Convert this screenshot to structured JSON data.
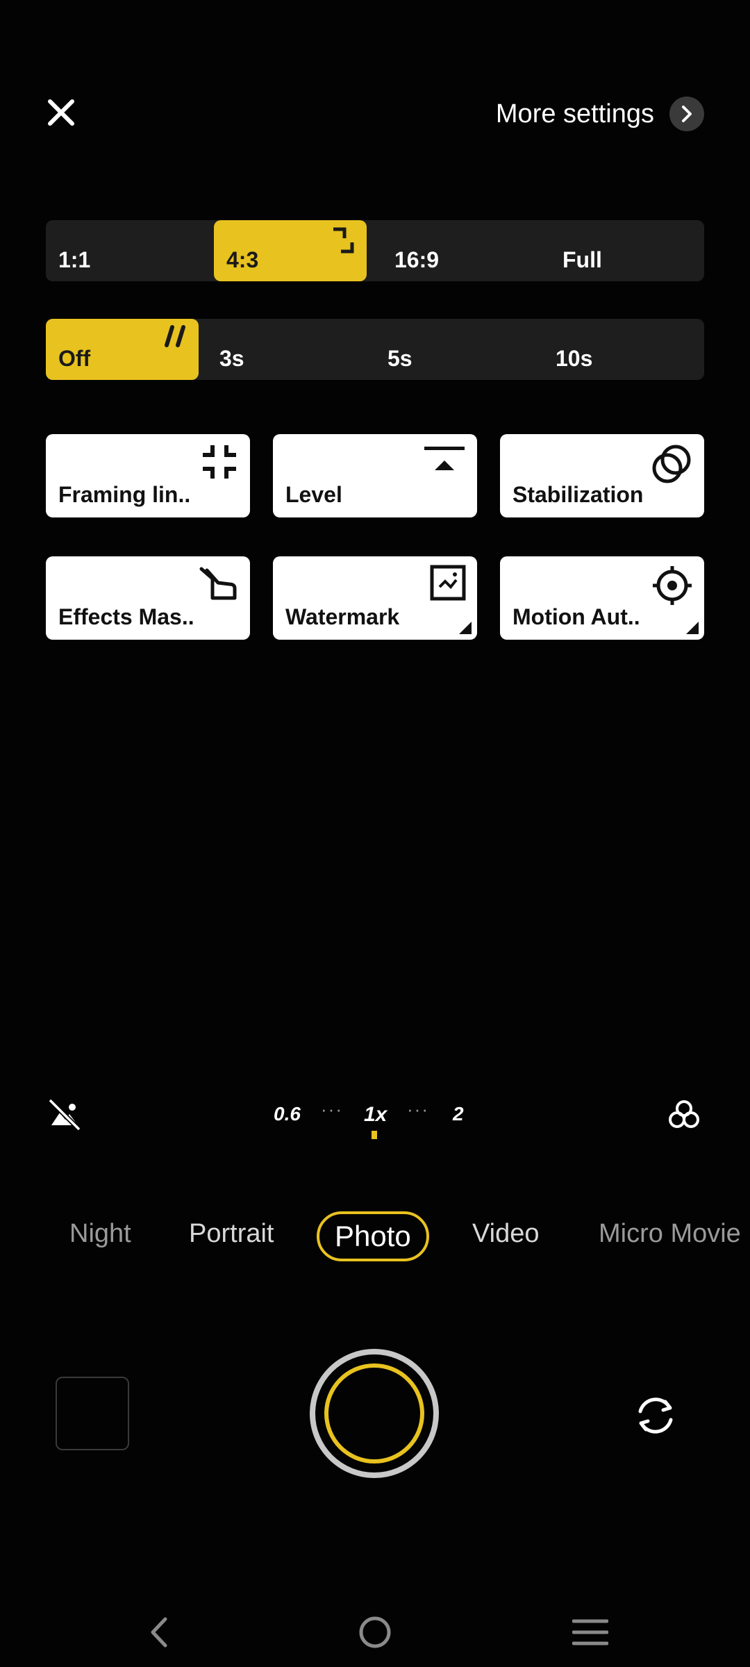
{
  "header": {
    "more_settings_label": "More settings"
  },
  "aspect_ratio": {
    "options": [
      "1:1",
      "4:3",
      "16:9",
      "Full"
    ],
    "selected": "4:3"
  },
  "timer": {
    "options": [
      "Off",
      "3s",
      "5s",
      "10s"
    ],
    "selected": "Off"
  },
  "tiles": [
    {
      "label": "Framing lin..",
      "icon": "framing-lines-icon"
    },
    {
      "label": "Level",
      "icon": "level-icon"
    },
    {
      "label": "Stabilization",
      "icon": "stabilization-icon"
    },
    {
      "label": "Effects Mas..",
      "icon": "effects-master-icon"
    },
    {
      "label": "Watermark",
      "icon": "watermark-icon"
    },
    {
      "label": "Motion Aut..",
      "icon": "motion-autofocus-icon"
    }
  ],
  "zoom": {
    "levels": [
      "0.6",
      "1x",
      "2"
    ],
    "selected": "1x"
  },
  "modes": {
    "items": [
      "Night",
      "Portrait",
      "Photo",
      "Video",
      "Micro Movie"
    ],
    "selected": "Photo"
  },
  "colors": {
    "accent": "#e8c21f",
    "background": "#030303",
    "tile": "#ffffff"
  }
}
